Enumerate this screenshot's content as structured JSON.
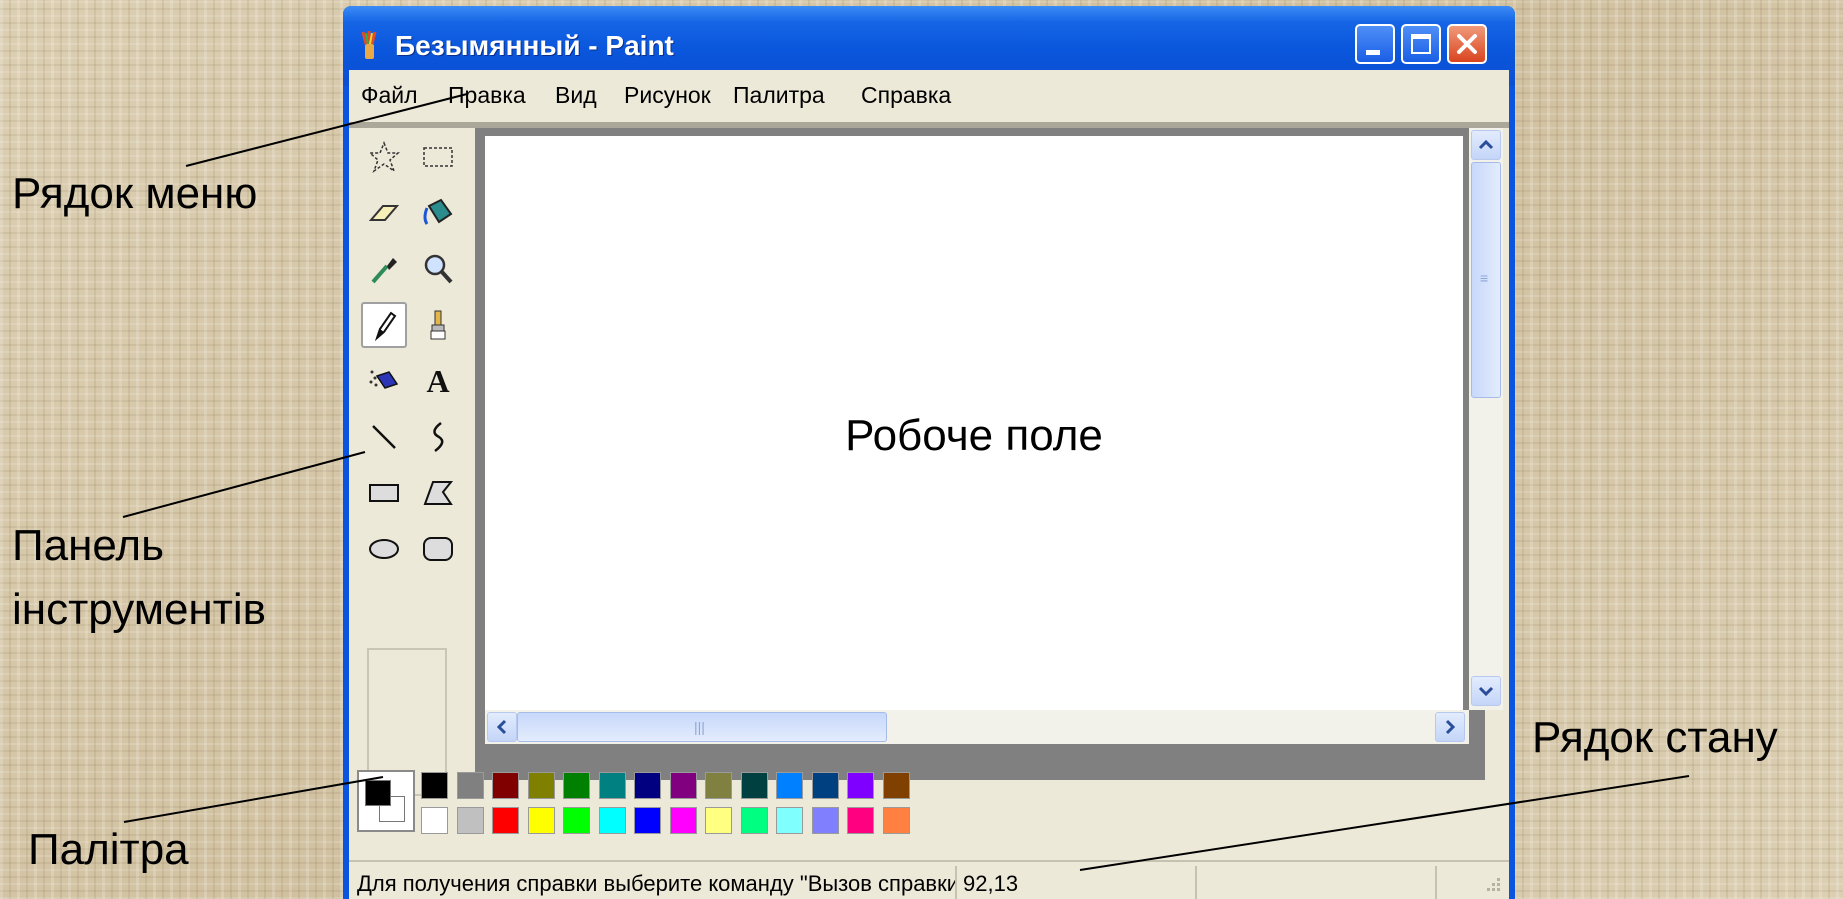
{
  "callouts": {
    "menu_bar": "Рядок меню",
    "toolbox_line1": "Панель",
    "toolbox_line2": "інструментів",
    "palette": "Палітра",
    "status_bar": "Рядок стану",
    "work_area": "Робоче поле"
  },
  "window": {
    "title": "Безымянный - Paint",
    "controls": [
      "minimize",
      "maximize",
      "close"
    ]
  },
  "menu": {
    "items": [
      "Файл",
      "Правка",
      "Вид",
      "Рисунок",
      "Палитра",
      "Справка"
    ]
  },
  "toolbox": {
    "tools": [
      {
        "name": "free-form-select-icon"
      },
      {
        "name": "rect-select-icon"
      },
      {
        "name": "eraser-icon"
      },
      {
        "name": "fill-bucket-icon"
      },
      {
        "name": "color-picker-icon"
      },
      {
        "name": "magnifier-icon"
      },
      {
        "name": "pencil-icon",
        "selected": true
      },
      {
        "name": "brush-icon"
      },
      {
        "name": "airbrush-icon"
      },
      {
        "name": "text-icon",
        "glyph": "A"
      },
      {
        "name": "line-icon"
      },
      {
        "name": "curve-icon"
      },
      {
        "name": "rectangle-icon"
      },
      {
        "name": "polygon-icon"
      },
      {
        "name": "ellipse-icon"
      },
      {
        "name": "rounded-rectangle-icon"
      }
    ]
  },
  "palette": {
    "foreground": "#000000",
    "background": "#ffffff",
    "top_row": [
      "#000000",
      "#808080",
      "#800000",
      "#808000",
      "#008000",
      "#008080",
      "#000080",
      "#800080",
      "#808040",
      "#004040",
      "#0080ff",
      "#004080",
      "#8000ff",
      "#804000"
    ],
    "bottom_row": [
      "#ffffff",
      "#c0c0c0",
      "#ff0000",
      "#ffff00",
      "#00ff00",
      "#00ffff",
      "#0000ff",
      "#ff00ff",
      "#ffff80",
      "#00ff80",
      "#80ffff",
      "#8080ff",
      "#ff0080",
      "#ff8040"
    ]
  },
  "status": {
    "message": "Для получения справки выберите команду \"Вызов справки\"",
    "coords": "92,13"
  }
}
